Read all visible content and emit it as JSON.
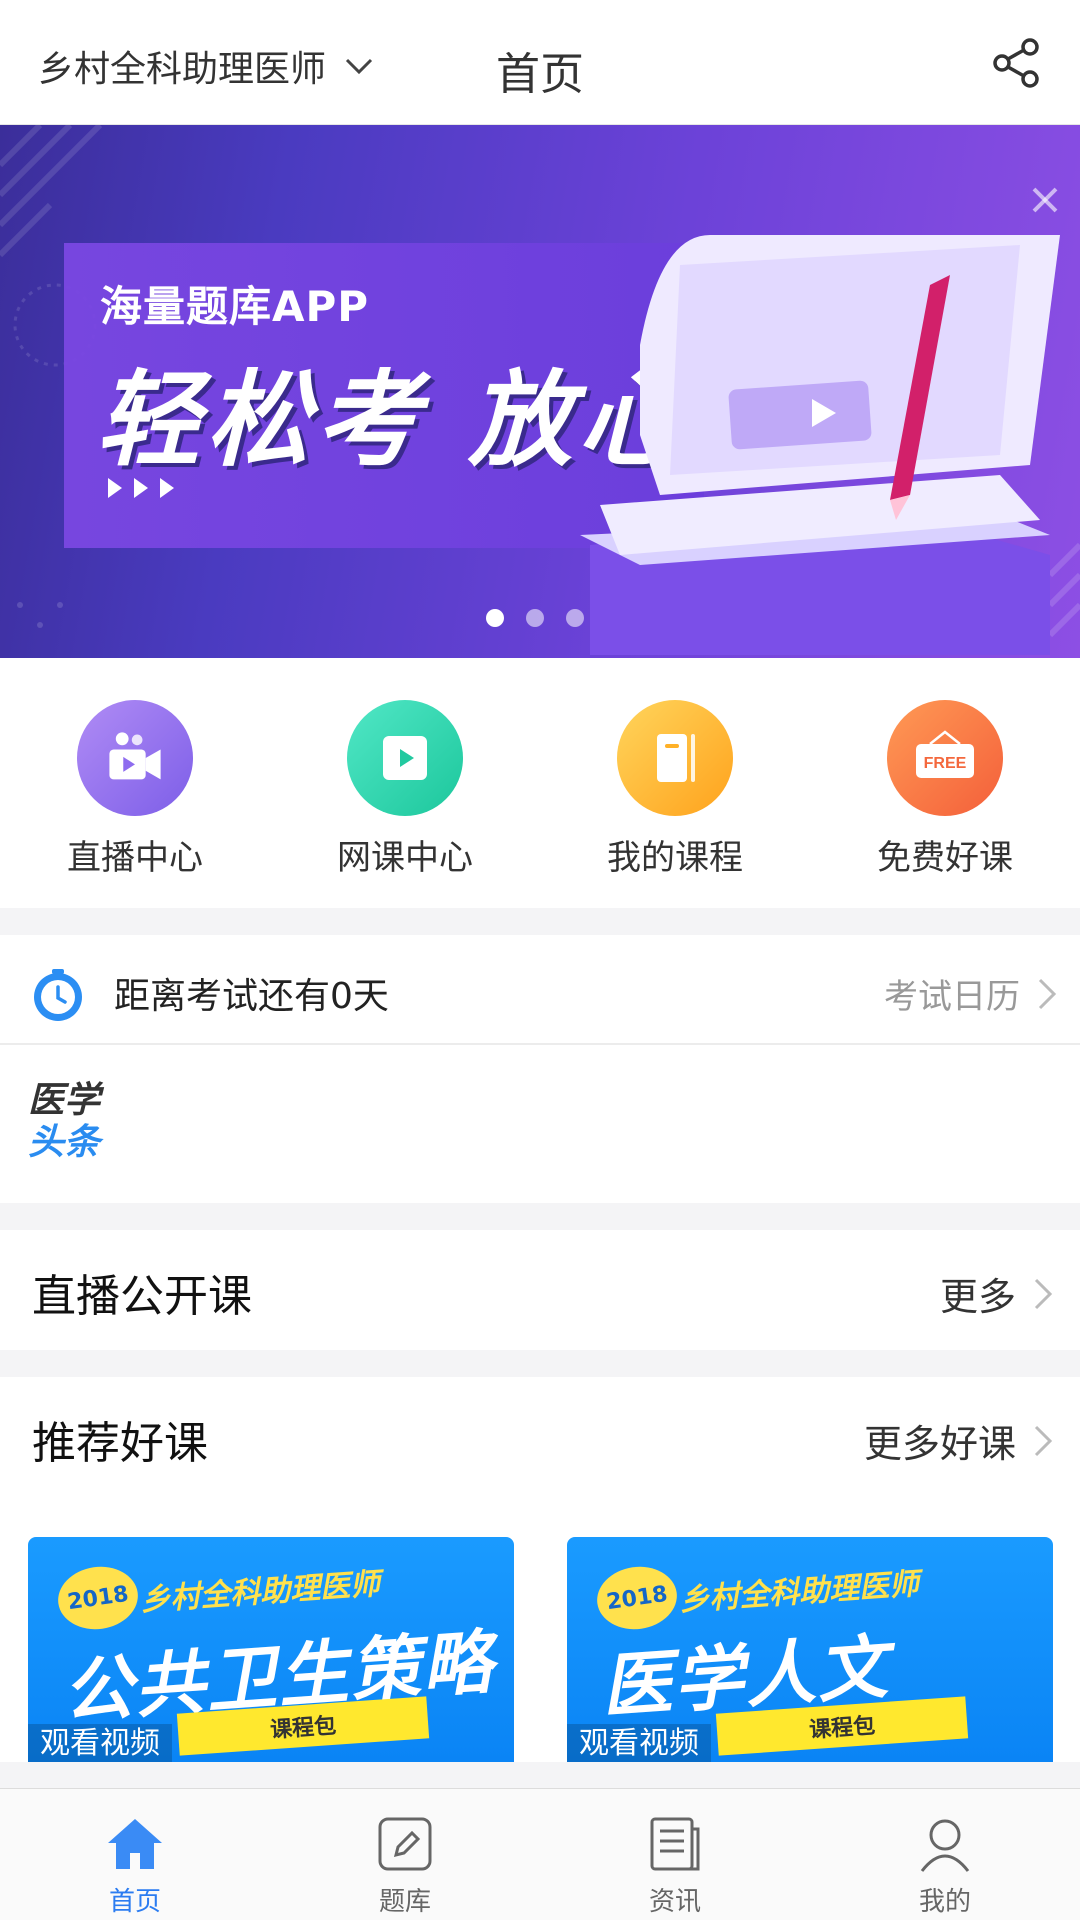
{
  "header": {
    "exam_selector": "乡村全科助理医师",
    "title": "首页"
  },
  "banner": {
    "subtitle": "海量题库APP",
    "headline": "轻松考 放心过",
    "slide_count": 3,
    "active_slide": 1
  },
  "quick_entries": [
    {
      "label": "直播中心",
      "icon": "video-camera-icon"
    },
    {
      "label": "网课中心",
      "icon": "play-icon"
    },
    {
      "label": "我的课程",
      "icon": "book-icon"
    },
    {
      "label": "免费好课",
      "icon": "free-sign-icon",
      "icon_text": "FREE"
    }
  ],
  "countdown": {
    "text": "距离考试还有0天",
    "calendar_link": "考试日历"
  },
  "news": {
    "logo_line1": "医学",
    "logo_line2": "头条"
  },
  "live_section": {
    "title": "直播公开课",
    "more": "更多"
  },
  "recommend_section": {
    "title": "推荐好课",
    "more": "更多好课",
    "cards": [
      {
        "year": "2018",
        "subtitle": "乡村全科助理医师",
        "title": "公共卫生策略",
        "tag": "课程包",
        "action": "观看视频"
      },
      {
        "year": "2018",
        "subtitle": "乡村全科助理医师",
        "title": "医学人文",
        "tag": "课程包",
        "action": "观看视频"
      }
    ]
  },
  "tabbar": {
    "items": [
      {
        "label": "首页",
        "icon": "home-icon",
        "active": true
      },
      {
        "label": "题库",
        "icon": "pen-icon",
        "active": false
      },
      {
        "label": "资讯",
        "icon": "news-icon",
        "active": false
      },
      {
        "label": "我的",
        "icon": "user-icon",
        "active": false
      }
    ]
  },
  "colors": {
    "accent": "#2b7cf1",
    "banner_purple": "#6c42d8"
  }
}
